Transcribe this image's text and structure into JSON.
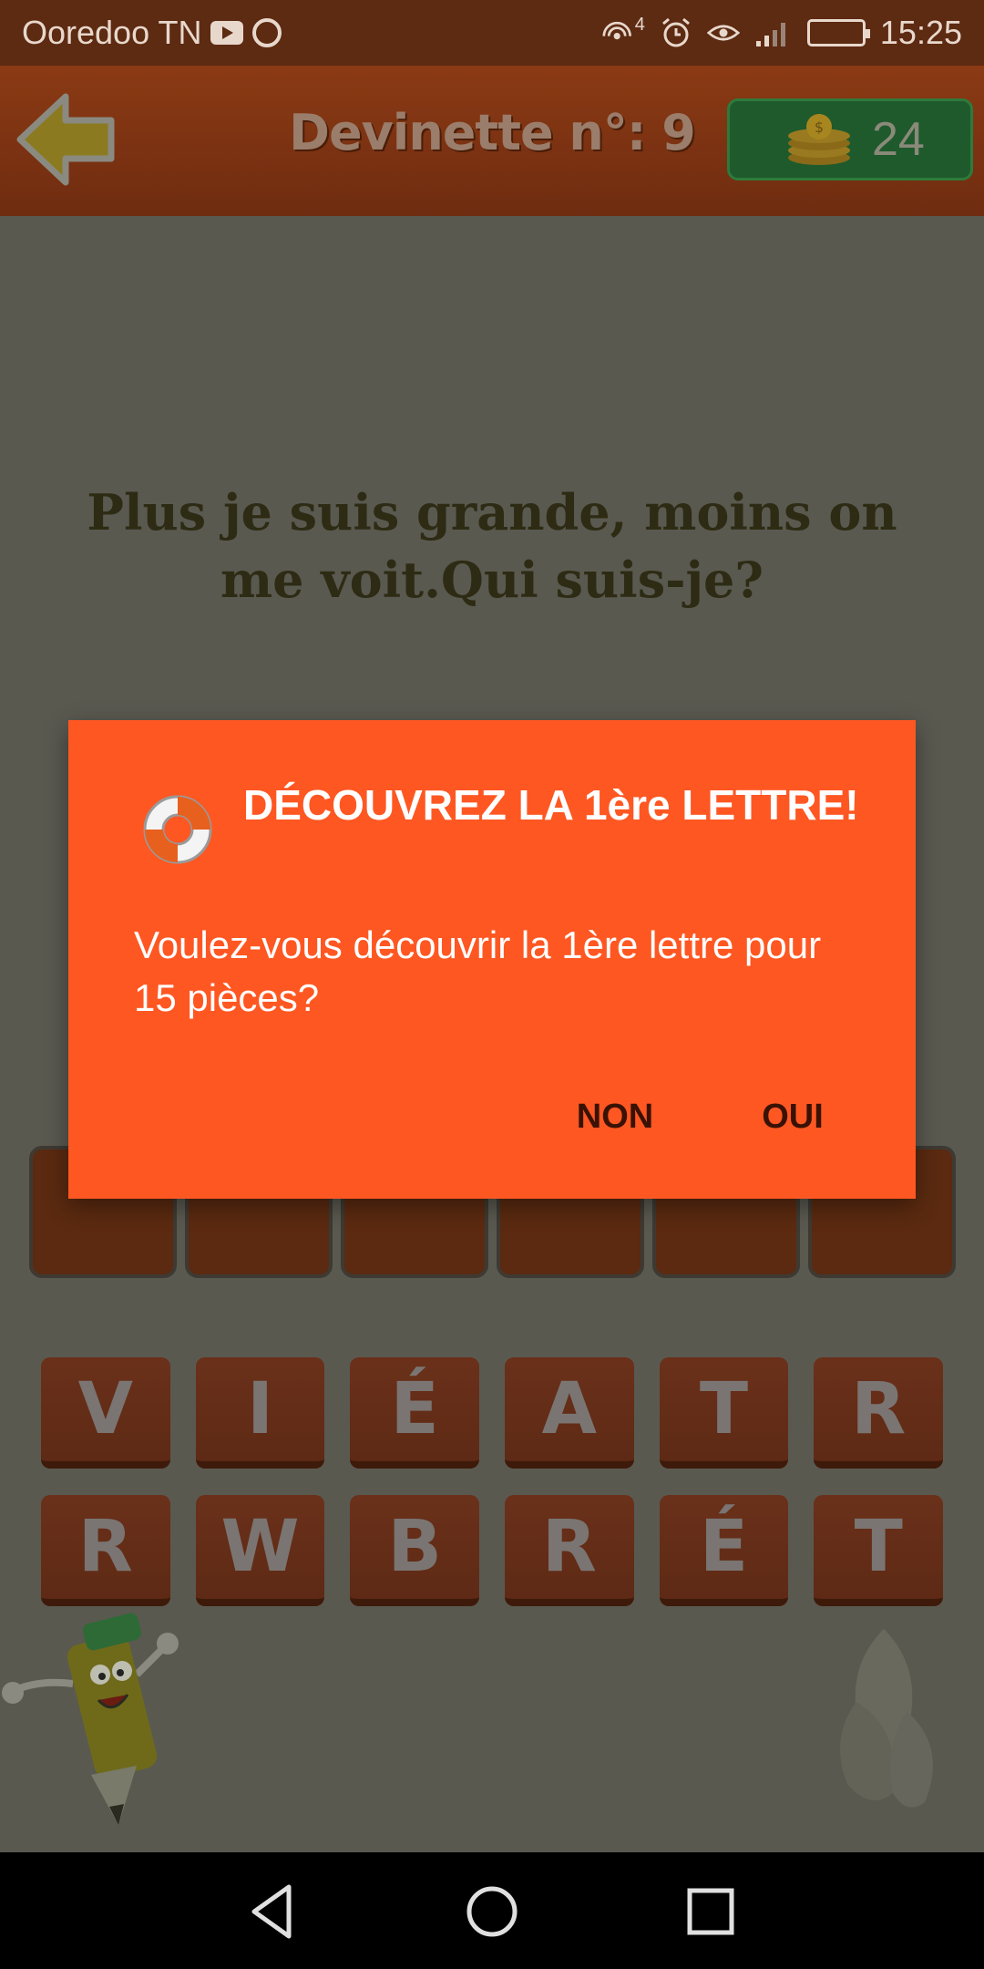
{
  "status_bar": {
    "carrier": "Ooredoo TN",
    "network_badge": "4",
    "time": "15:25",
    "icons": [
      "youtube-icon",
      "hotspot-icon",
      "wifi-icon",
      "alarm-icon",
      "eye-icon",
      "signal-icon",
      "battery-icon"
    ]
  },
  "header": {
    "title": "Devinette n°: 9",
    "coins": "24",
    "icons": [
      "back-arrow-icon",
      "coin-stack-icon"
    ]
  },
  "game": {
    "question": "Plus je suis grande, moins on me voit.Qui suis-je?",
    "answer_slot_count": 6,
    "letters_row1": [
      "V",
      "I",
      "É",
      "A",
      "T",
      "R"
    ],
    "letters_row2": [
      "R",
      "W",
      "B",
      "R",
      "É",
      "T"
    ]
  },
  "dialog": {
    "icon": "lifebuoy-icon",
    "title": "DÉCOUVREZ LA 1ère LETTRE!",
    "message": "Voulez-vous découvrir la 1ère lettre pour 15 pièces?",
    "no_label": "NON",
    "yes_label": "OUI"
  },
  "nav_bar": {
    "icons": [
      "back-nav-icon",
      "home-nav-icon",
      "recents-nav-icon"
    ]
  },
  "colors": {
    "status_bar": "#5d2a12",
    "header": "#7a3212",
    "dim_background": "#5a5950",
    "dialog": "#ff5722",
    "coin_box": "#1f5a2c",
    "tile": "#652e18"
  }
}
